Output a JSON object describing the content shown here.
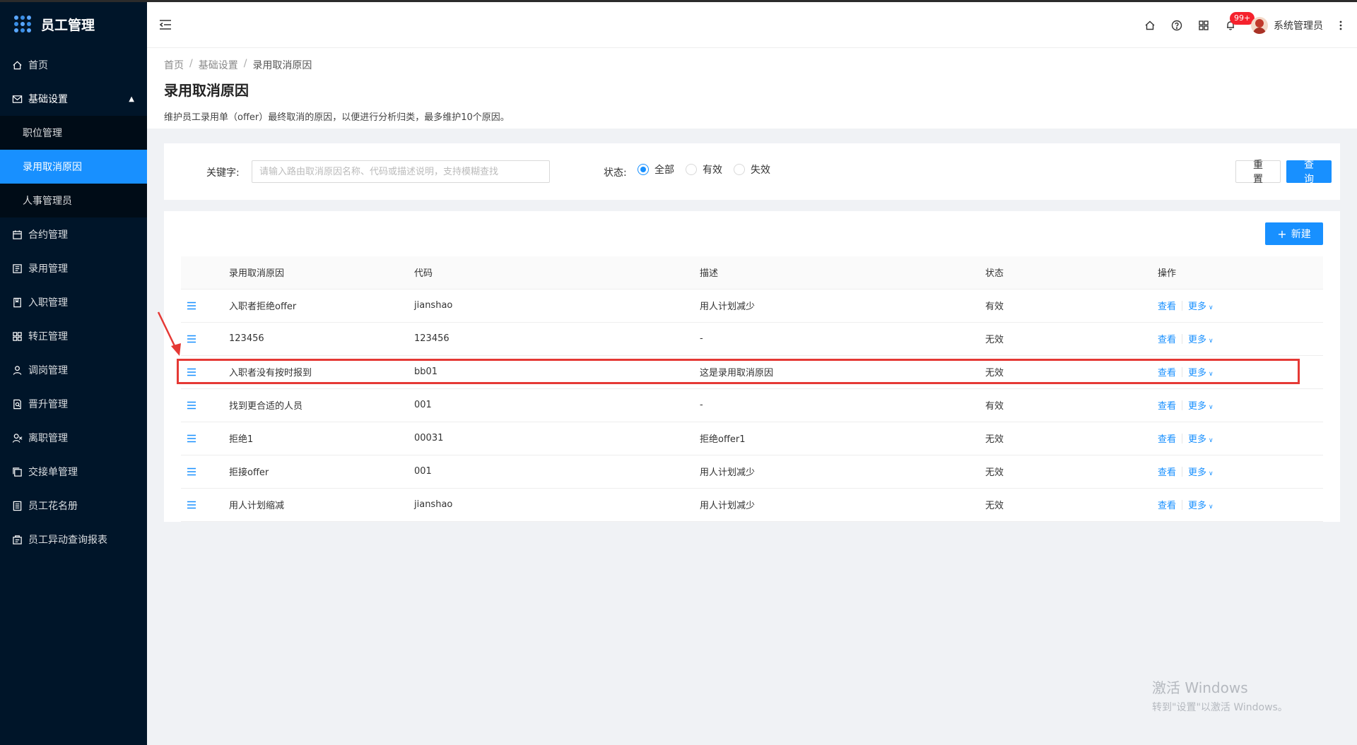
{
  "app": {
    "title": "员工管理"
  },
  "sidebar": {
    "items": [
      {
        "label": "首页",
        "icon": "home-icon"
      },
      {
        "label": "基础设置",
        "icon": "mail-icon",
        "open": true,
        "children": [
          {
            "label": "职位管理"
          },
          {
            "label": "录用取消原因",
            "active": true
          },
          {
            "label": "人事管理员"
          }
        ]
      },
      {
        "label": "合约管理",
        "icon": "calendar-icon"
      },
      {
        "label": "录用管理",
        "icon": "form-icon"
      },
      {
        "label": "入职管理",
        "icon": "book-icon"
      },
      {
        "label": "转正管理",
        "icon": "apps-icon"
      },
      {
        "label": "调岗管理",
        "icon": "user-icon"
      },
      {
        "label": "晋升管理",
        "icon": "doc-search-icon"
      },
      {
        "label": "离职管理",
        "icon": "user-remove-icon"
      },
      {
        "label": "交接单管理",
        "icon": "copy-icon"
      },
      {
        "label": "员工花名册",
        "icon": "list-icon"
      },
      {
        "label": "员工异动查询报表",
        "icon": "report-icon"
      }
    ]
  },
  "header": {
    "notification_badge": "99+",
    "username": "系统管理员"
  },
  "breadcrumb": [
    "首页",
    "基础设置",
    "录用取消原因"
  ],
  "page": {
    "title": "录用取消原因",
    "description": "维护员工录用单（offer）最终取消的原因，以便进行分析归类，最多维护10个原因。"
  },
  "search": {
    "keyword_label": "关键字:",
    "keyword_placeholder": "请输入路由取消原因名称、代码或描述说明，支持模糊查找",
    "keyword_value": "",
    "status_label": "状态:",
    "status_options": [
      "全部",
      "有效",
      "失效"
    ],
    "status_selected": "全部",
    "reset_label": "重 置",
    "query_label": "查 询"
  },
  "table": {
    "new_label": "新建",
    "columns": [
      "录用取消原因",
      "代码",
      "描述",
      "状态",
      "操作"
    ],
    "rows": [
      {
        "name": "入职者拒绝offer",
        "code": "jianshao",
        "desc": "用人计划减少",
        "status": "有效"
      },
      {
        "name": "123456",
        "code": "123456",
        "desc": "-",
        "status": "无效"
      },
      {
        "name": "入职者没有按时报到",
        "code": "bb01",
        "desc": "这是录用取消原因",
        "status": "无效"
      },
      {
        "name": "找到更合适的人员",
        "code": "001",
        "desc": "-",
        "status": "有效"
      },
      {
        "name": "拒绝1",
        "code": "00031",
        "desc": "拒绝offer1",
        "status": "无效"
      },
      {
        "name": "拒接offer",
        "code": "001",
        "desc": "用人计划减少",
        "status": "无效"
      },
      {
        "name": "用人计划缩减",
        "code": "jianshao",
        "desc": "用人计划减少",
        "status": "无效"
      }
    ],
    "view_label": "查看",
    "more_label": "更多"
  },
  "watermark": {
    "line1": "激活 Windows",
    "line2": "转到\"设置\"以激活 Windows。"
  },
  "colors": {
    "sidebar_bg": "#001529",
    "accent": "#1890ff",
    "highlight": "#e53935"
  }
}
